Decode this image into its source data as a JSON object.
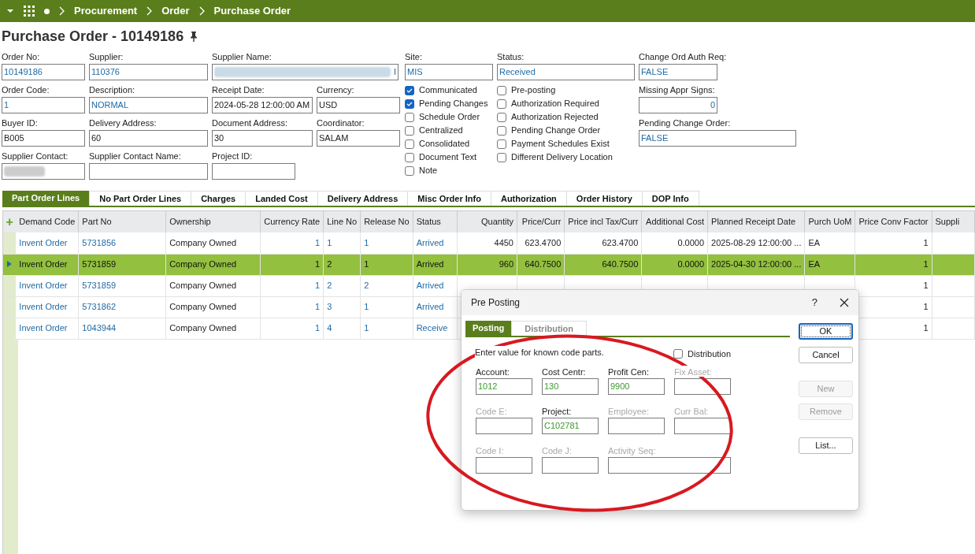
{
  "breadcrumb": [
    "Procurement",
    "Order",
    "Purchase Order"
  ],
  "title": "Purchase Order - 10149186",
  "header_fields": [
    [
      {
        "label": "Order No:",
        "value": "10149186",
        "linked": true
      },
      {
        "label": "Supplier:",
        "value": "110376",
        "linked": true
      },
      {
        "label": "Supplier Name:",
        "value": "I",
        "linked": true,
        "redacted": true
      }
    ],
    [
      {
        "label": "Order Code:",
        "value": "1",
        "linked": true
      },
      {
        "label": "Description:",
        "value": "NORMAL",
        "linked": true
      },
      {
        "label": "Receipt Date:",
        "value": "2024-05-28 12:00:00 AM",
        "linked": false
      },
      {
        "label": "Currency:",
        "value": "USD",
        "linked": false
      }
    ],
    [
      {
        "label": "Buyer ID:",
        "value": "B005",
        "linked": false
      },
      {
        "label": "Delivery Address:",
        "value": "60",
        "linked": false
      },
      {
        "label": "Document Address:",
        "value": "30",
        "linked": false
      },
      {
        "label": "Coordinator:",
        "value": "SALAM",
        "linked": false
      }
    ],
    [
      {
        "label": "Supplier Contact:",
        "redacted": true
      },
      {
        "label": "Supplier Contact Name:"
      },
      {
        "label": "Project ID:"
      }
    ]
  ],
  "site": {
    "label": "Site:",
    "value": "MIS"
  },
  "status": {
    "label": "Status:",
    "value": "Received"
  },
  "flags_1": [
    {
      "label": "Communicated",
      "checked": true
    },
    {
      "label": "Pending Changes",
      "checked": true
    },
    {
      "label": "Schedule Order",
      "checked": false
    },
    {
      "label": "Centralized",
      "checked": false
    },
    {
      "label": "Consolidated",
      "checked": false
    },
    {
      "label": "Document Text",
      "checked": false
    },
    {
      "label": "Note",
      "checked": false
    }
  ],
  "flags_2": [
    {
      "label": "Pre-posting",
      "checked": false
    },
    {
      "label": "Authorization Required",
      "checked": false
    },
    {
      "label": "Authorization Rejected",
      "checked": false
    },
    {
      "label": "Pending Change Order",
      "checked": false
    },
    {
      "label": "Payment Schedules Exist",
      "checked": false
    },
    {
      "label": "Different Delivery Location",
      "checked": false
    }
  ],
  "right_fields": [
    {
      "label": "Change Ord Auth Req:",
      "value": "FALSE"
    },
    {
      "label": "Missing Appr Signs:",
      "value": "0"
    },
    {
      "label": "Pending Change Order:",
      "value": "FALSE"
    }
  ],
  "tabs": [
    {
      "label": "Part Order Lines",
      "selected": true
    },
    {
      "label": "No Part Order Lines",
      "selected": false
    },
    {
      "label": "Charges",
      "selected": false
    },
    {
      "label": "Landed Cost",
      "selected": false
    },
    {
      "label": "Delivery Address",
      "selected": false
    },
    {
      "label": "Misc Order Info",
      "selected": false
    },
    {
      "label": "Authorization",
      "selected": false
    },
    {
      "label": "Order History",
      "selected": false
    },
    {
      "label": "DOP Info",
      "selected": false
    }
  ],
  "table": {
    "add_symbol": "+",
    "columns": [
      "Demand Code",
      "Part No",
      "Ownership",
      "Currency Rate",
      "Line No",
      "Release No",
      "Status",
      "Quantity",
      "Price/Curr",
      "Price incl Tax/Curr",
      "Additional Cost",
      "Planned Receipt Date",
      "Purch UoM",
      "Price Conv Factor",
      "Suppli"
    ],
    "rows": [
      {
        "selected": false,
        "cells": [
          "Invent Order",
          "5731856",
          "Company Owned",
          "1",
          "1",
          "1",
          "Arrived",
          "4450",
          "623.4700",
          "623.4700",
          "0.0000",
          "2025-08-29 12:00:00 ...",
          "EA",
          "1",
          null
        ]
      },
      {
        "selected": true,
        "cells": [
          "Invent Order",
          "5731859",
          "Company Owned",
          "1",
          "2",
          "1",
          "Arrived",
          "960",
          "640.7500",
          "640.7500",
          "0.0000",
          "2025-04-30 12:00:00 ...",
          "EA",
          "1",
          null
        ]
      },
      {
        "selected": false,
        "cells": [
          "Invent Order",
          "5731859",
          "Company Owned",
          "1",
          "2",
          "2",
          "Arrived",
          null,
          null,
          null,
          null,
          null,
          null,
          "1",
          null
        ]
      },
      {
        "selected": false,
        "cells": [
          "Invent Order",
          "5731862",
          "Company Owned",
          "1",
          "3",
          "1",
          "Arrived",
          null,
          null,
          null,
          null,
          null,
          null,
          "1",
          null
        ]
      },
      {
        "selected": false,
        "cells": [
          "Invent Order",
          "1043944",
          "Company Owned",
          "1",
          "4",
          "1",
          "Receive",
          null,
          null,
          null,
          null,
          null,
          null,
          "1",
          null
        ]
      }
    ]
  },
  "dialog": {
    "title": "Pre Posting",
    "help": "?",
    "tabs": [
      {
        "label": "Posting",
        "selected": true
      },
      {
        "label": "Distribution",
        "selected": false
      }
    ],
    "hint": "Enter value for known code parts.",
    "distribution": {
      "label": "Distribution",
      "checked": false
    },
    "fields": [
      [
        {
          "label": "Account:",
          "value": "1012",
          "disabled": false
        },
        {
          "label": "Cost Centr:",
          "value": "130",
          "disabled": false
        },
        {
          "label": "Profit Cen:",
          "value": "9900",
          "disabled": false
        },
        {
          "label": "Fix Asset:",
          "disabled": true
        }
      ],
      [
        {
          "label": "Code E:",
          "disabled": true
        },
        {
          "label": "Project:",
          "value": "C102781",
          "disabled": false
        },
        {
          "label": "Employee:",
          "disabled": true
        },
        {
          "label": "Curr Bal:",
          "disabled": true
        }
      ],
      [
        {
          "label": "Code I:",
          "disabled": true
        },
        {
          "label": "Code J:",
          "disabled": true
        },
        {
          "label": "Activity Seq:",
          "disabled": true
        }
      ]
    ],
    "buttons": [
      {
        "label": "OK",
        "disabled": false,
        "focused": true
      },
      {
        "label": "Cancel",
        "disabled": false,
        "focused": false
      },
      {
        "label": "New",
        "disabled": true,
        "focused": false
      },
      {
        "label": "Remove",
        "disabled": true,
        "focused": false
      },
      {
        "label": "List...",
        "disabled": false,
        "focused": false
      }
    ]
  }
}
